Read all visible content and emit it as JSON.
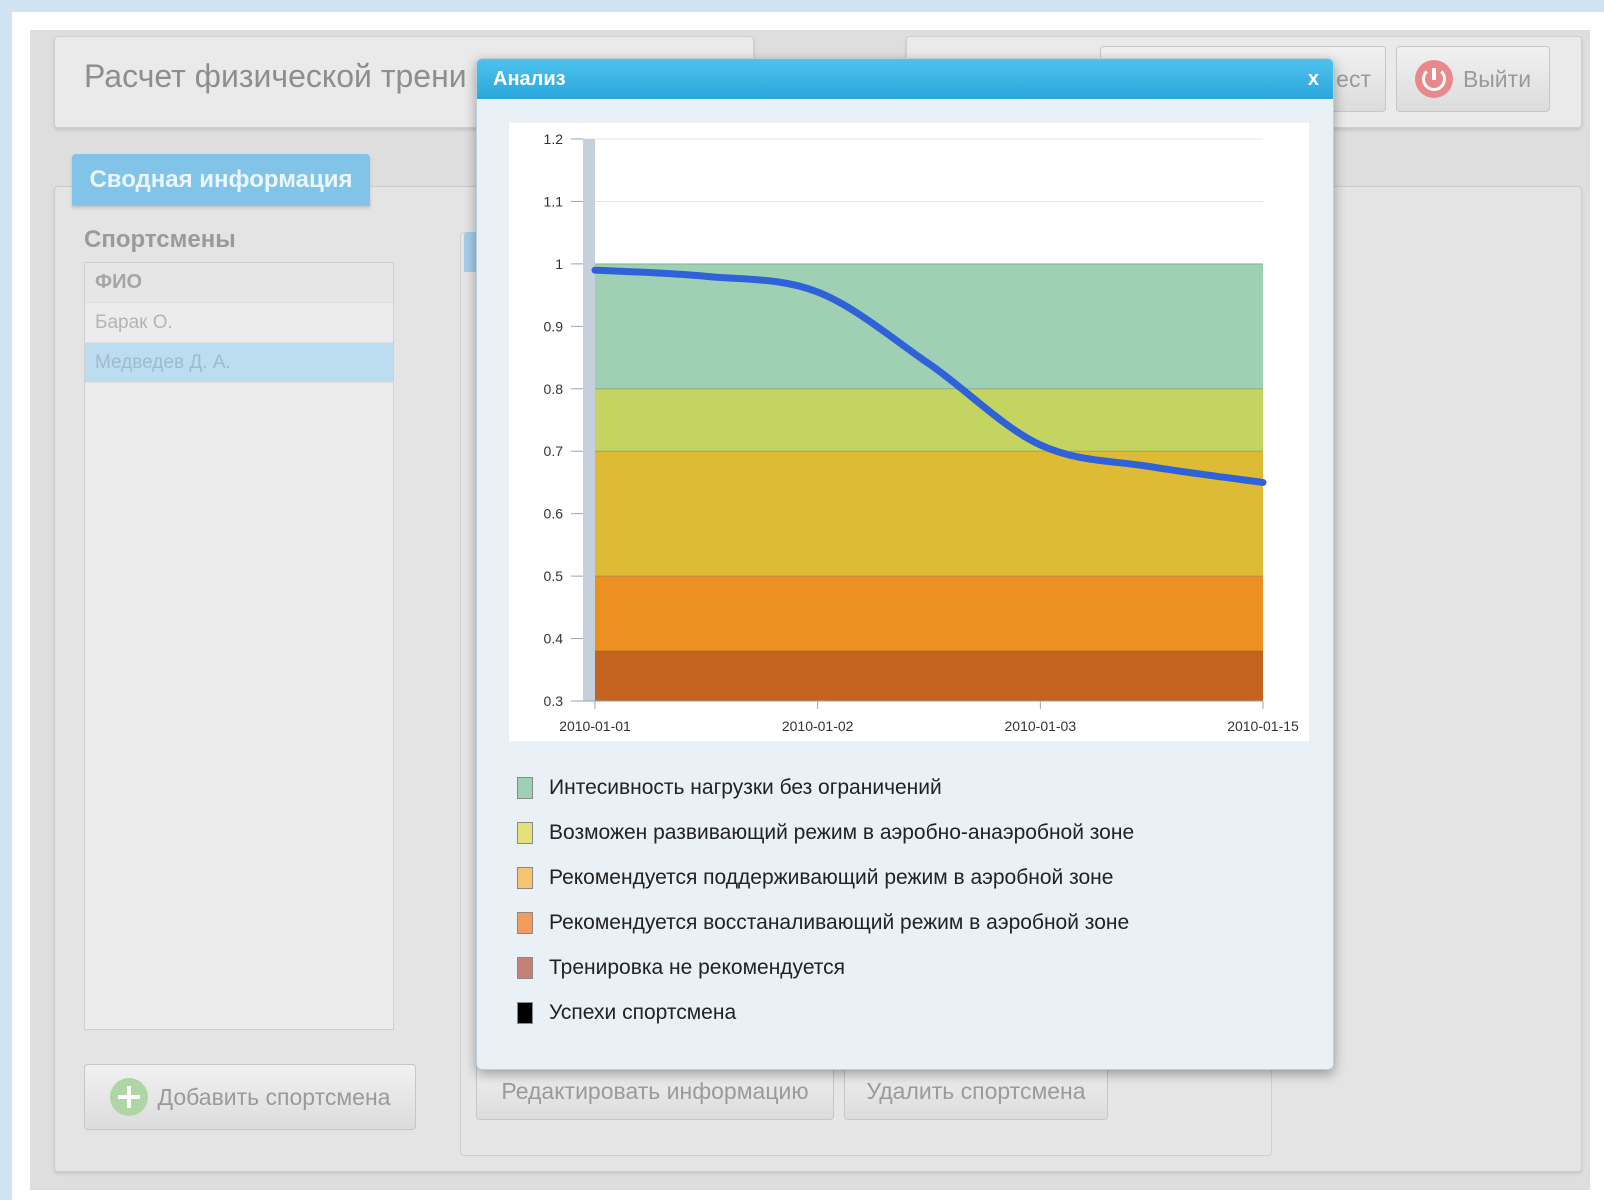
{
  "header": {
    "app_title": "Расчет физической трени",
    "partial_button_label": "ест",
    "exit_label": "Выйти"
  },
  "tabs": {
    "summary": "Сводная информация"
  },
  "athletes": {
    "section_title": "Спортсмены",
    "column_header": "ФИО",
    "rows": [
      "Барак О.",
      "Медведев Д. А."
    ],
    "selected_index": 1,
    "add_button": "Добавить спортсмена"
  },
  "actions": {
    "edit": "Редактировать информацию",
    "delete": "Удалить спортсмена"
  },
  "dialog": {
    "title": "Анализ",
    "close": "x"
  },
  "chart_data": {
    "type": "area",
    "x_categories": [
      "2010-01-01",
      "2010-01-02",
      "2010-01-03",
      "2010-01-15"
    ],
    "y_ticks": [
      "0.3",
      "0.4",
      "0.5",
      "0.6",
      "0.7",
      "0.8",
      "0.9",
      "1",
      "1.1",
      "1.2"
    ],
    "ylim": [
      0.3,
      1.2
    ],
    "bands": [
      {
        "from": 0.3,
        "to": 0.38,
        "color": "#c4621f"
      },
      {
        "from": 0.38,
        "to": 0.5,
        "color": "#ec9121"
      },
      {
        "from": 0.5,
        "to": 0.7,
        "color": "#debb35"
      },
      {
        "from": 0.7,
        "to": 0.8,
        "color": "#c3d460"
      },
      {
        "from": 0.8,
        "to": 1.0,
        "color": "#9fd0b3"
      }
    ],
    "series": [
      {
        "color": "#2f62d8",
        "x": [
          0,
          0.5,
          1,
          1.5,
          2,
          2.5,
          3
        ],
        "values": [
          0.99,
          0.98,
          0.955,
          0.84,
          0.71,
          0.675,
          0.65
        ]
      }
    ],
    "legend": [
      {
        "label": "Интесивность нагрузки без ограничений",
        "color": "#9fd0b3"
      },
      {
        "label": "Возможен развивающий режим в аэробно-анаэробной зоне",
        "color": "#e4e07a"
      },
      {
        "label": "Рекомендуется поддерживающий режим в аэробной зоне",
        "color": "#f6c46e"
      },
      {
        "label": "Рекомендуется восстаналивающий режим в аэробной зоне",
        "color": "#f19c5d"
      },
      {
        "label": "Тренировка не рекомендуется",
        "color": "#c47f76"
      },
      {
        "label": "Успехи спортсмена",
        "color": "#000000"
      }
    ]
  }
}
